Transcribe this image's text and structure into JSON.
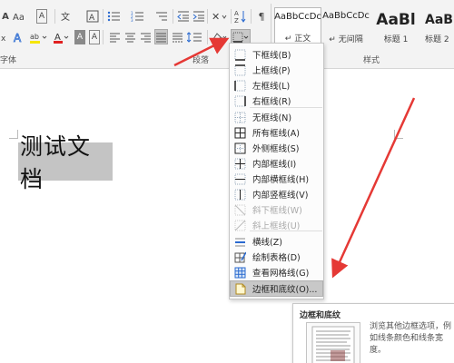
{
  "ribbon": {
    "groups": {
      "font": "字体",
      "paragraph": "段落",
      "styles": "样式"
    },
    "styles": [
      {
        "preview": "AaBbCcDc",
        "name": "↵ 正文"
      },
      {
        "preview": "AaBbCcDc",
        "name": "↵ 无间隔"
      },
      {
        "preview": "AaBl",
        "name": "标题 1"
      },
      {
        "preview": "AaBb",
        "name": "标题 2"
      }
    ],
    "buttons": {
      "bold_underline": "A",
      "text_color": "A",
      "highlight": "ab",
      "char_shading": "A",
      "clear": "A",
      "sort": "A↓",
      "show_marks": "¶"
    }
  },
  "document": {
    "text": "测试文档"
  },
  "menu": {
    "items": [
      {
        "label": "下框线(B)",
        "icon": "bottom-border-icon",
        "enabled": true
      },
      {
        "label": "上框线(P)",
        "icon": "top-border-icon",
        "enabled": true
      },
      {
        "label": "左框线(L)",
        "icon": "left-border-icon",
        "enabled": true
      },
      {
        "label": "右框线(R)",
        "icon": "right-border-icon",
        "enabled": true
      },
      {
        "label": "无框线(N)",
        "icon": "no-border-icon",
        "enabled": true
      },
      {
        "label": "所有框线(A)",
        "icon": "all-borders-icon",
        "enabled": true
      },
      {
        "label": "外侧框线(S)",
        "icon": "outside-borders-icon",
        "enabled": true
      },
      {
        "label": "内部框线(I)",
        "icon": "inside-borders-icon",
        "enabled": true
      },
      {
        "label": "内部横框线(H)",
        "icon": "inside-horizontal-border-icon",
        "enabled": true
      },
      {
        "label": "内部竖框线(V)",
        "icon": "inside-vertical-border-icon",
        "enabled": true
      },
      {
        "label": "斜下框线(W)",
        "icon": "diagonal-down-border-icon",
        "enabled": false
      },
      {
        "label": "斜上框线(U)",
        "icon": "diagonal-up-border-icon",
        "enabled": false
      },
      {
        "label": "横线(Z)",
        "icon": "horizontal-line-icon",
        "enabled": true
      },
      {
        "label": "绘制表格(D)",
        "icon": "draw-table-icon",
        "enabled": true
      },
      {
        "label": "查看网格线(G)",
        "icon": "view-gridlines-icon",
        "enabled": true
      },
      {
        "label": "边框和底纹(O)...",
        "icon": "borders-shading-icon",
        "enabled": true,
        "highlighted": true
      }
    ]
  },
  "tooltip": {
    "title": "边框和底纹",
    "body": "浏览其他边框选项，例如线条颜色和线条宽度。"
  },
  "colors": {
    "arrow": "#e53935",
    "highlight_text": "#c4c4c4",
    "font_color_bar": "#e02020",
    "highlight_bar": "#f6e600"
  }
}
